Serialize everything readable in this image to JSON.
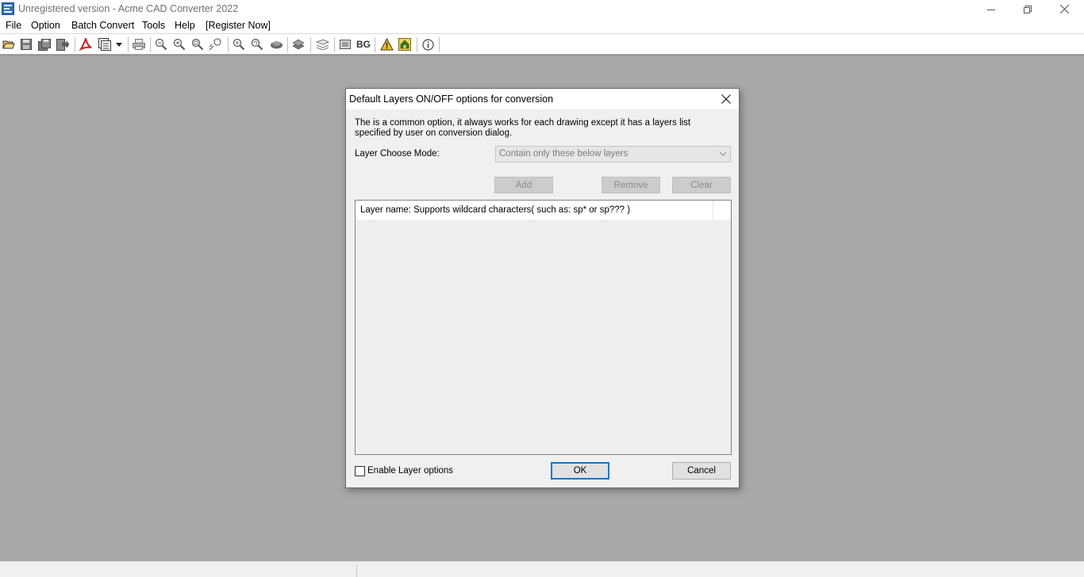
{
  "window": {
    "title": "Unregistered version - Acme CAD Converter 2022"
  },
  "menu": {
    "items": [
      {
        "label": "File"
      },
      {
        "label": "Option"
      },
      {
        "label": "Batch Convert"
      },
      {
        "label": "Tools"
      },
      {
        "label": "Help"
      },
      {
        "label": "[Register Now]"
      }
    ]
  },
  "toolbar": {
    "bg_label": "BG",
    "icons": [
      "open-folder-icon",
      "save-icon",
      "save-all-icon",
      "export-icon",
      "pdf-icon",
      "batch-icon",
      "dropdown-icon",
      "print-icon",
      "zoom-out-icon",
      "zoom-in-icon",
      "zoom-window-icon",
      "zoom-realtime-icon",
      "zoom-extents-icon",
      "zoom-previous-icon",
      "pan-icon",
      "layers-icon",
      "layout-icon",
      "frame-icon",
      "bg-color-icon",
      "warning-icon",
      "home-icon",
      "info-icon"
    ]
  },
  "dialog": {
    "title": "Default Layers ON/OFF options for conversion",
    "description": "The is a common option, it always works for each drawing except it has a layers list specified by user on conversion dialog.",
    "mode_label": "Layer Choose Mode:",
    "mode_value": "Contain only these below layers",
    "add_label": "Add",
    "remove_label": "Remove",
    "clear_label": "Clear",
    "list_header": "Layer name: Supports wildcard characters( such as: sp* or sp??? )",
    "enable_label": "Enable Layer options",
    "enable_checked": false,
    "ok_label": "OK",
    "cancel_label": "Cancel"
  },
  "colors": {
    "workspace": "#a8a8a8",
    "dialog_bg": "#f0f0f0",
    "focus_accent": "#0078d7"
  }
}
